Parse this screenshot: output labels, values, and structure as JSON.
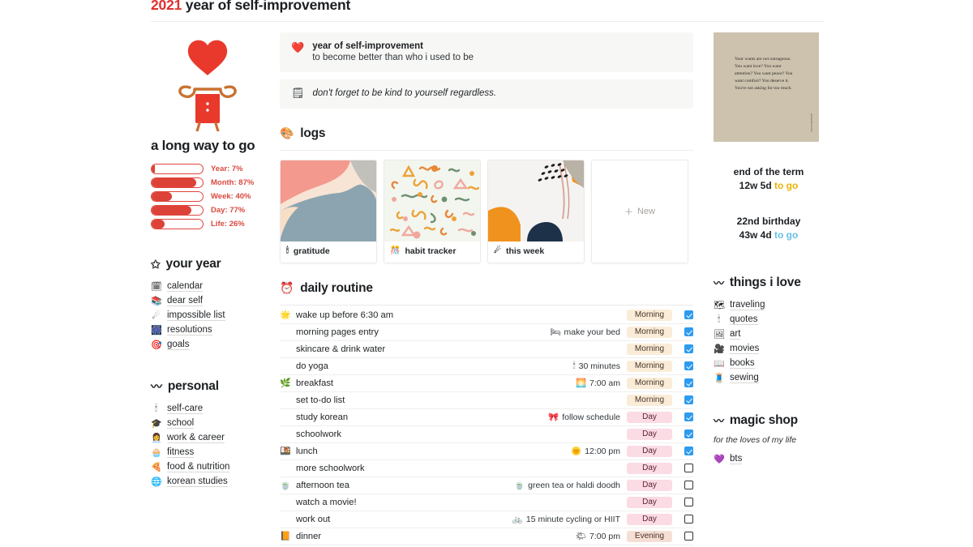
{
  "page_title": {
    "year": "2021",
    "rest": " year of self-improvement"
  },
  "left": {
    "illustration_name": "heart-head-figure",
    "heading": "a long way to go",
    "progress": [
      {
        "label": "Year: 7%",
        "percent": 7
      },
      {
        "label": "Month: 87%",
        "percent": 87
      },
      {
        "label": "Week: 40%",
        "percent": 40
      },
      {
        "label": "Day: 77%",
        "percent": 77
      },
      {
        "label": "Life: 26%",
        "percent": 26
      }
    ],
    "groups": [
      {
        "heading": "your year",
        "heading_icon": "star-icon",
        "heading_glyph": "✩",
        "items": [
          {
            "label": "calendar",
            "icon": "calendar-icon",
            "glyph": "🗓"
          },
          {
            "label": "dear self",
            "icon": "books-icon",
            "glyph": "📚"
          },
          {
            "label": "impossible list",
            "icon": "comet-icon",
            "glyph": "☄"
          },
          {
            "label": "resolutions",
            "icon": "fireworks-icon",
            "glyph": "🎆"
          },
          {
            "label": "goals",
            "icon": "target-icon",
            "glyph": "🎯"
          }
        ]
      },
      {
        "heading": "personal",
        "heading_icon": "wave-icon",
        "heading_glyph": "〰",
        "items": [
          {
            "label": "self-care",
            "icon": "candle-icon",
            "glyph": "🕯"
          },
          {
            "label": "school",
            "icon": "graduation-cap-icon",
            "glyph": "🎓"
          },
          {
            "label": "work & career",
            "icon": "office-worker-icon",
            "glyph": "👩‍💼"
          },
          {
            "label": "fitness",
            "icon": "cupcake-icon",
            "glyph": "🧁"
          },
          {
            "label": "food & nutrition",
            "icon": "pizza-icon",
            "glyph": "🍕"
          },
          {
            "label": "korean studies",
            "icon": "globe-icon",
            "glyph": "🌐"
          }
        ]
      }
    ]
  },
  "main": {
    "callout_primary": {
      "icon": "heart-icon",
      "glyph": "❤️",
      "title": "year of self-improvement",
      "subtitle": "to become better than who i used to be"
    },
    "callout_secondary": {
      "icon": "sticky-note-icon",
      "glyph": "🗒",
      "text": "don't forget to be kind to yourself regardless."
    },
    "logs": {
      "heading": "logs",
      "heading_icon": "artist-palette-icon",
      "heading_glyph": "🎨",
      "cards": [
        {
          "label": "gratitude",
          "icon": "candle-icon",
          "glyph": "🕯",
          "thumb": "abstract-pink-blue"
        },
        {
          "label": "habit tracker",
          "icon": "confetti-icon",
          "glyph": "🎊",
          "thumb": "squiggle-pattern"
        },
        {
          "label": "this week",
          "icon": "comet-icon",
          "glyph": "☄",
          "thumb": "abstract-orange-navy"
        }
      ],
      "new_label": "New"
    },
    "routine": {
      "heading": "daily routine",
      "heading_icon": "alarm-clock-icon",
      "heading_glyph": "⏰",
      "rows": [
        {
          "icon": "sun-icon",
          "glyph": "🌟",
          "name": "wake up before 6:30 am",
          "note": "",
          "note_icon": "",
          "note_glyph": "",
          "tag": "Morning",
          "tag_type": "morning",
          "checked": true
        },
        {
          "icon": "",
          "glyph": "",
          "name": "morning pages entry",
          "note": "make your bed",
          "note_icon": "bed-icon",
          "note_glyph": "🛏",
          "tag": "Morning",
          "tag_type": "morning",
          "checked": true
        },
        {
          "icon": "",
          "glyph": "",
          "name": "skincare & drink water",
          "note": "",
          "note_icon": "",
          "note_glyph": "",
          "tag": "Morning",
          "tag_type": "morning",
          "checked": true
        },
        {
          "icon": "",
          "glyph": "",
          "name": "do yoga",
          "note": "30 minutes",
          "note_icon": "candle-icon",
          "note_glyph": "🕯",
          "tag": "Morning",
          "tag_type": "morning",
          "checked": true
        },
        {
          "icon": "herb-icon",
          "glyph": "🌿",
          "name": "breakfast",
          "note": "7:00 am",
          "note_icon": "sunrise-icon",
          "note_glyph": "🌅",
          "tag": "Morning",
          "tag_type": "morning",
          "checked": true
        },
        {
          "icon": "",
          "glyph": "",
          "name": "set to-do list",
          "note": "",
          "note_icon": "",
          "note_glyph": "",
          "tag": "Morning",
          "tag_type": "morning",
          "checked": true
        },
        {
          "icon": "",
          "glyph": "",
          "name": "study korean",
          "note": "follow schedule",
          "note_icon": "ribbon-icon",
          "note_glyph": "🎀",
          "tag": "Day",
          "tag_type": "day",
          "checked": true
        },
        {
          "icon": "",
          "glyph": "",
          "name": "schoolwork",
          "note": "",
          "note_icon": "",
          "note_glyph": "",
          "tag": "Day",
          "tag_type": "day",
          "checked": true
        },
        {
          "icon": "bento-icon",
          "glyph": "🍱",
          "name": "lunch",
          "note": "12:00 pm",
          "note_icon": "sun-icon",
          "note_glyph": "🌞",
          "tag": "Day",
          "tag_type": "day",
          "checked": true
        },
        {
          "icon": "",
          "glyph": "",
          "name": "more schoolwork",
          "note": "",
          "note_icon": "",
          "note_glyph": "",
          "tag": "Day",
          "tag_type": "day",
          "checked": false
        },
        {
          "icon": "teacup-icon",
          "glyph": "🍵",
          "name": "afternoon tea",
          "note": "green tea or haldi doodh",
          "note_icon": "teacup-icon",
          "note_glyph": "🍵",
          "tag": "Day",
          "tag_type": "day",
          "checked": false
        },
        {
          "icon": "",
          "glyph": "",
          "name": "watch a movie!",
          "note": "",
          "note_icon": "",
          "note_glyph": "",
          "tag": "Day",
          "tag_type": "day",
          "checked": false
        },
        {
          "icon": "",
          "glyph": "",
          "name": "work out",
          "note": "15 minute cycling or HIIT",
          "note_icon": "bicycle-icon",
          "note_glyph": "🚲",
          "tag": "Day",
          "tag_type": "day",
          "checked": false
        },
        {
          "icon": "open-book-icon",
          "glyph": "📙",
          "name": "dinner",
          "note": "7:00 pm",
          "note_icon": "sunset-icon",
          "note_glyph": "🌤",
          "tag": "Evening",
          "tag_type": "evening",
          "checked": false
        }
      ]
    }
  },
  "right": {
    "quote_image": {
      "name": "quote-card-image",
      "text": "Your wants are not outrageous. You want love? You want attention? You want peace? You want comfort? You deserve it. You're not asking for too much.",
      "credit": "@hannahbrencher"
    },
    "countdowns": [
      {
        "title": "end of the term",
        "value": "12w 5d",
        "suffix": "to go",
        "suffix_color": "#e9b306"
      },
      {
        "title": "22nd birthday",
        "value": "43w 4d",
        "suffix": "to go",
        "suffix_color": "#68c0e8"
      }
    ],
    "groups": [
      {
        "heading": "things i love",
        "heading_icon": "wave-icon",
        "heading_glyph": "〰",
        "subtitle": "",
        "items": [
          {
            "label": "traveling",
            "icon": "world-map-icon",
            "glyph": "🗺"
          },
          {
            "label": "quotes",
            "icon": "candle-icon",
            "glyph": "🕯"
          },
          {
            "label": "art",
            "icon": "framed-art-icon",
            "glyph": "🖼"
          },
          {
            "label": "movies",
            "icon": "movie-camera-icon",
            "glyph": "🎥"
          },
          {
            "label": "books",
            "icon": "open-book-icon",
            "glyph": "📖"
          },
          {
            "label": "sewing",
            "icon": "thread-icon",
            "glyph": "🧵"
          }
        ]
      },
      {
        "heading": "magic shop",
        "heading_icon": "wave-icon",
        "heading_glyph": "〰",
        "subtitle": "for the loves of my life",
        "items": [
          {
            "label": "bts",
            "icon": "purple-hearts-icon",
            "glyph": "💜"
          }
        ]
      }
    ]
  }
}
